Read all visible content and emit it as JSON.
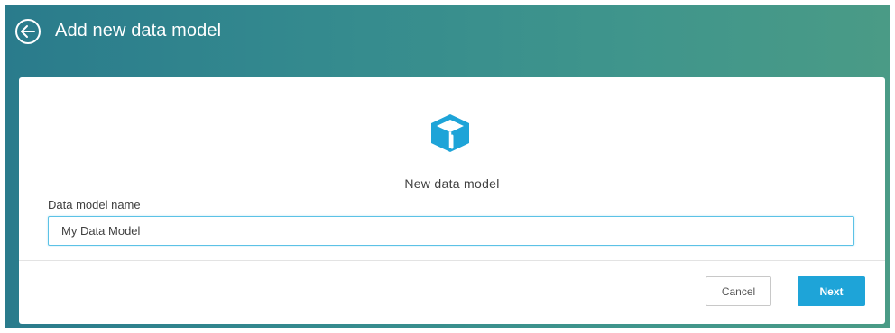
{
  "header": {
    "title": "Add new data model",
    "back_icon": "back-arrow-circle-icon"
  },
  "card": {
    "icon": "cube-icon",
    "icon_color": "#1ea4d8",
    "model_type_label": "New data model",
    "field": {
      "label": "Data model name",
      "value": "My Data Model"
    },
    "buttons": {
      "cancel_label": "Cancel",
      "next_label": "Next"
    }
  },
  "colors": {
    "header_gradient_start": "#2a7b8c",
    "header_gradient_end": "#4a9b86",
    "accent": "#1ea4d8"
  }
}
